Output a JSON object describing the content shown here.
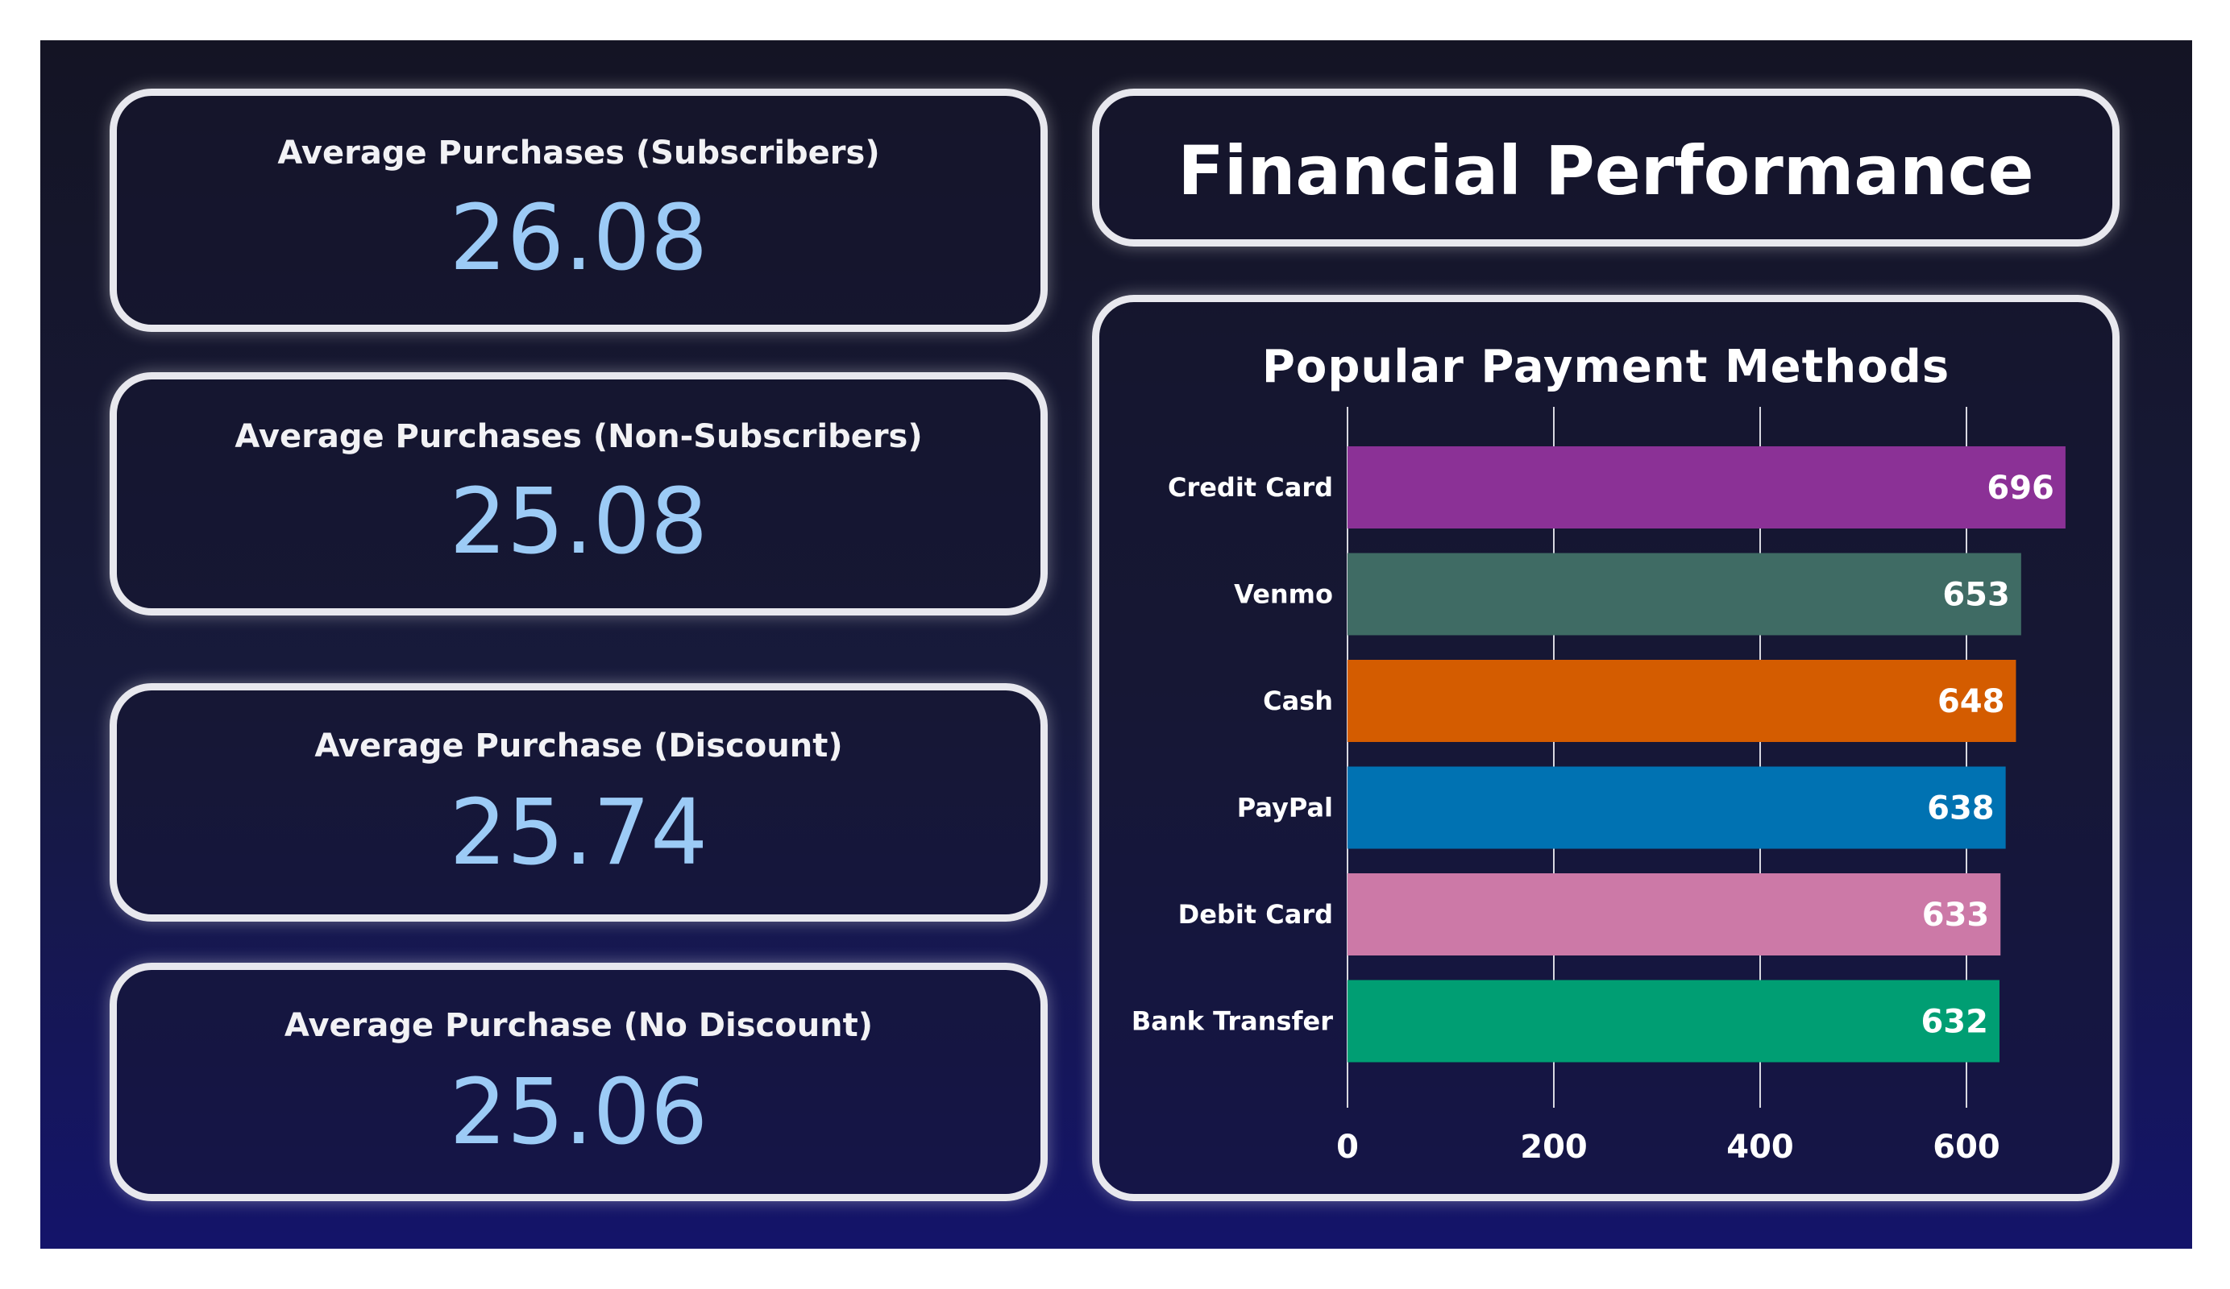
{
  "kpis": [
    {
      "label": "Average Purchases (Subscribers)",
      "value": "26.08"
    },
    {
      "label": "Average Purchases (Non-Subscribers)",
      "value": "25.08"
    },
    {
      "label": "Average Purchase (Discount)",
      "value": "25.74"
    },
    {
      "label": "Average Purchase (No Discount)",
      "value": "25.06"
    }
  ],
  "header": {
    "title": "Financial Performance"
  },
  "chart_data": {
    "type": "bar",
    "orientation": "horizontal",
    "title": "Popular Payment Methods",
    "categories": [
      "Credit Card",
      "Venmo",
      "Cash",
      "PayPal",
      "Debit Card",
      "Bank Transfer"
    ],
    "values": [
      696,
      653,
      648,
      638,
      633,
      632
    ],
    "colors": [
      "#8b3196",
      "#3f6b64",
      "#d45c00",
      "#0072b2",
      "#cc79a7",
      "#009e73"
    ],
    "xlim": [
      0,
      700
    ],
    "xticks": [
      0,
      200,
      400,
      600
    ],
    "grid": true,
    "data_labels": true
  }
}
